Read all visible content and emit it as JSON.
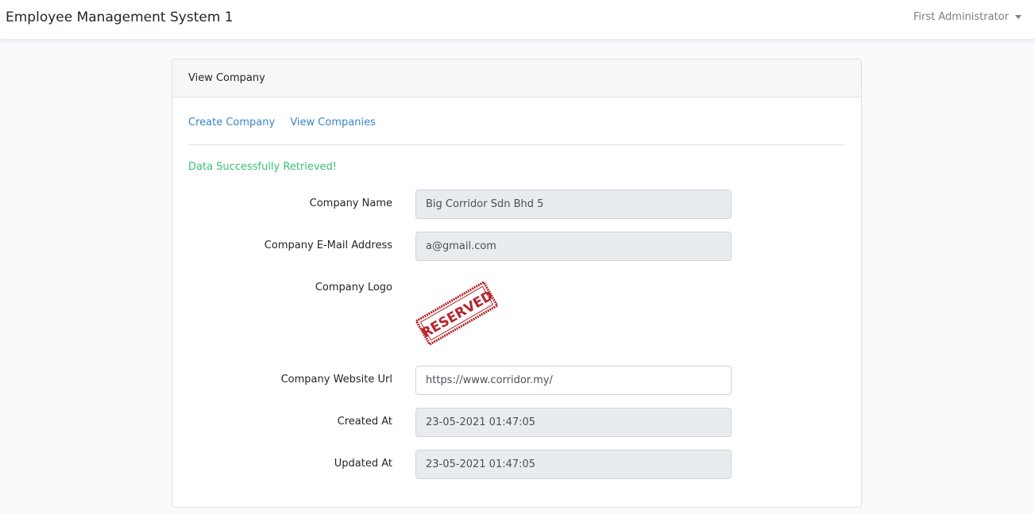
{
  "app": {
    "title": "Employee Management System 1",
    "user": "First Administrator"
  },
  "card": {
    "header": "View Company",
    "links": {
      "create": "Create Company",
      "view_all": "View Companies"
    },
    "status_message": "Data Successfully Retrieved!"
  },
  "fields": {
    "company_name": {
      "label": "Company Name",
      "value": "Big Corridor Sdn Bhd 5"
    },
    "company_email": {
      "label": "Company E-Mail Address",
      "value": "a@gmail.com"
    },
    "company_logo": {
      "label": "Company Logo",
      "logo_text": "RESERVED"
    },
    "company_website": {
      "label": "Company Website Url",
      "value": "https://www.corridor.my/"
    },
    "created_at": {
      "label": "Created At",
      "value": "23-05-2021 01:47:05"
    },
    "updated_at": {
      "label": "Updated At",
      "value": "23-05-2021 01:47:05"
    }
  },
  "colors": {
    "link": "#3a85c6",
    "success": "#38c172",
    "stamp": "#b3262c",
    "readonly_bg": "#e9ecef"
  }
}
